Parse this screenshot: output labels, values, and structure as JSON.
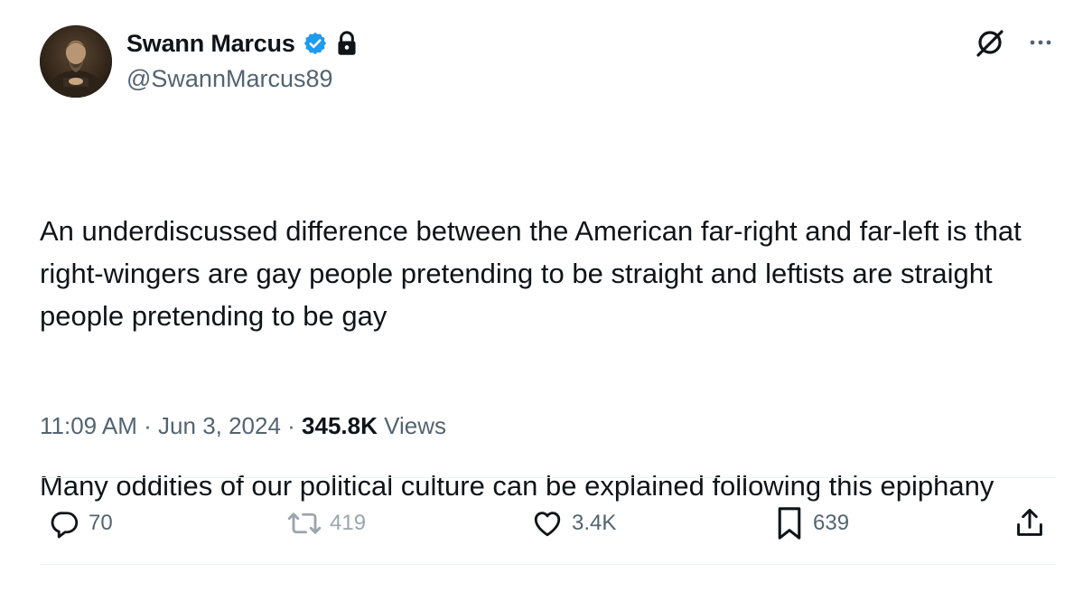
{
  "author": {
    "display_name": "Swann Marcus",
    "handle": "@SwannMarcus89",
    "verified": true,
    "protected": true,
    "avatar_icon": "portrait-avatar",
    "verified_color": "#1d9bf0"
  },
  "header_actions": [
    {
      "icon": "grok-icon"
    },
    {
      "icon": "more-icon"
    }
  ],
  "tweet": {
    "paragraphs": [
      "An underdiscussed difference between the American far-right and far-left is that right-wingers are gay people pretending to be straight and leftists are straight people pretending to be gay",
      "Many oddities of our political culture can be explained following this epiphany"
    ]
  },
  "meta": {
    "time": "11:09 AM",
    "sep1": " · ",
    "date": "Jun 3, 2024",
    "sep2": " · ",
    "views_count": "345.8K",
    "views_label": " Views"
  },
  "actions": {
    "reply": {
      "icon": "reply-icon",
      "count": "70"
    },
    "repost": {
      "icon": "repost-icon",
      "count": "419"
    },
    "like": {
      "icon": "heart-icon",
      "count": "3.4K"
    },
    "bookmark": {
      "icon": "bookmark-icon",
      "count": "639"
    },
    "share": {
      "icon": "share-icon"
    }
  },
  "colors": {
    "text_primary": "#0f1419",
    "text_secondary": "#536471",
    "divider": "#eff3f4"
  }
}
